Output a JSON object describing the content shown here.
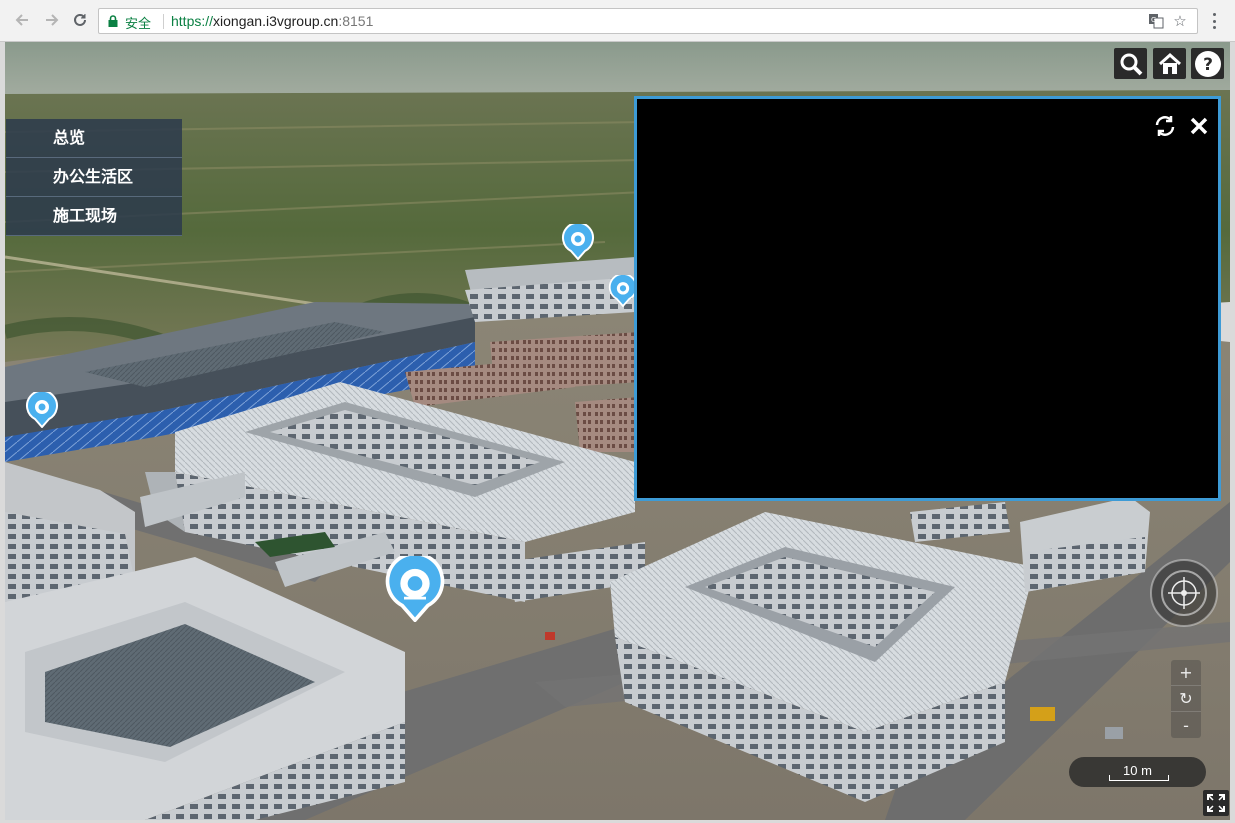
{
  "browser": {
    "secure_label": "安全",
    "url_scheme": "https://",
    "url_host": "xiongan.i3vgroup.cn",
    "url_port": ":8151"
  },
  "side_menu": {
    "items": [
      {
        "label": "总览"
      },
      {
        "label": "办公生活区"
      },
      {
        "label": "施工现场"
      }
    ]
  },
  "tools": {
    "search_icon": "search-icon",
    "home_icon": "home-icon",
    "help_icon": "help-icon"
  },
  "video_panel": {
    "refresh_icon": "refresh-icon",
    "close_icon": "close-icon"
  },
  "map_controls": {
    "zoom_in": "+",
    "reset": "↻",
    "zoom_out": "-",
    "scale_label": "10 m"
  },
  "colors": {
    "accent": "#3d9bd6",
    "menu_bg": "#2c3a4c",
    "secure_green": "#0b8043",
    "camera_marker": "#4ab0ee"
  }
}
